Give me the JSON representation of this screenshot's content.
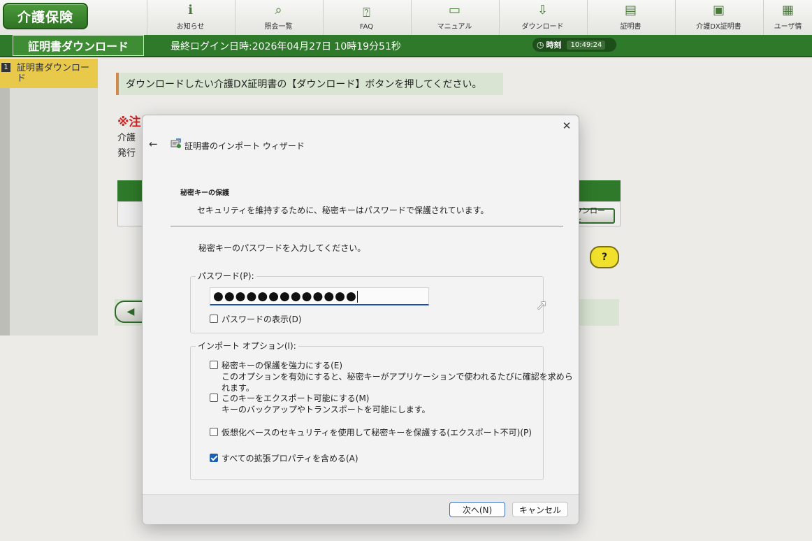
{
  "topnav": {
    "logo": "介護保険",
    "items": [
      {
        "label": "お知らせ",
        "icon": "info-icon"
      },
      {
        "label": "照会一覧",
        "icon": "magnifier-icon"
      },
      {
        "label": "FAQ",
        "icon": "faq-icon"
      },
      {
        "label": "マニュアル",
        "icon": "book-icon"
      },
      {
        "label": "ダウンロード",
        "icon": "download-icon"
      },
      {
        "label": "証明書",
        "icon": "certificate-icon"
      },
      {
        "label": "介護DX証明書",
        "icon": "dx-certificate-icon"
      },
      {
        "label": "ユーザ情",
        "icon": "user-icon"
      }
    ]
  },
  "titlebar": {
    "title": "証明書ダウンロード",
    "last_login": "最終ログイン日時:2026年04月27日 10時19分51秒",
    "clock_label": "時刻",
    "clock_time": "10:49:24"
  },
  "sidebar": {
    "items": [
      {
        "num": "1",
        "label": "証明書ダウンロード"
      }
    ]
  },
  "content": {
    "instruction": "ダウンロードしたい介護DX証明書の【ダウンロード】ボタンを押してください。",
    "warning": "※注",
    "line1": "介護",
    "line2": "発行",
    "download_btn": "ウンロード",
    "help": "?"
  },
  "dialog": {
    "title": "証明書のインポート ウィザード",
    "section_heading": "秘密キーの保護",
    "section_desc": "セキュリティを維持するために、秘密キーはパスワードで保護されています。",
    "prompt": "秘密キーのパスワードを入力してください。",
    "password_label": "パスワード(P):",
    "password_value": "●●●●●●●●●●●●●",
    "show_password": {
      "label": "パスワードの表示(D)",
      "checked": false
    },
    "import_options_label": "インポート オプション(I):",
    "options": [
      {
        "label": "秘密キーの保護を強力にする(E)",
        "desc": "このオプションを有効にすると、秘密キーがアプリケーションで使われるたびに確認を求められます。",
        "checked": false
      },
      {
        "label": "このキーをエクスポート可能にする(M)",
        "desc": "キーのバックアップやトランスポートを可能にします。",
        "checked": false
      },
      {
        "label": "仮想化ベースのセキュリティを使用して秘密キーを保護する(エクスポート不可)(P)",
        "desc": "",
        "checked": false
      },
      {
        "label": "すべての拡張プロパティを含める(A)",
        "desc": "",
        "checked": true
      }
    ],
    "next_button": "次へ(N)",
    "cancel_button": "キャンセル",
    "close": "✕",
    "back": "←"
  }
}
